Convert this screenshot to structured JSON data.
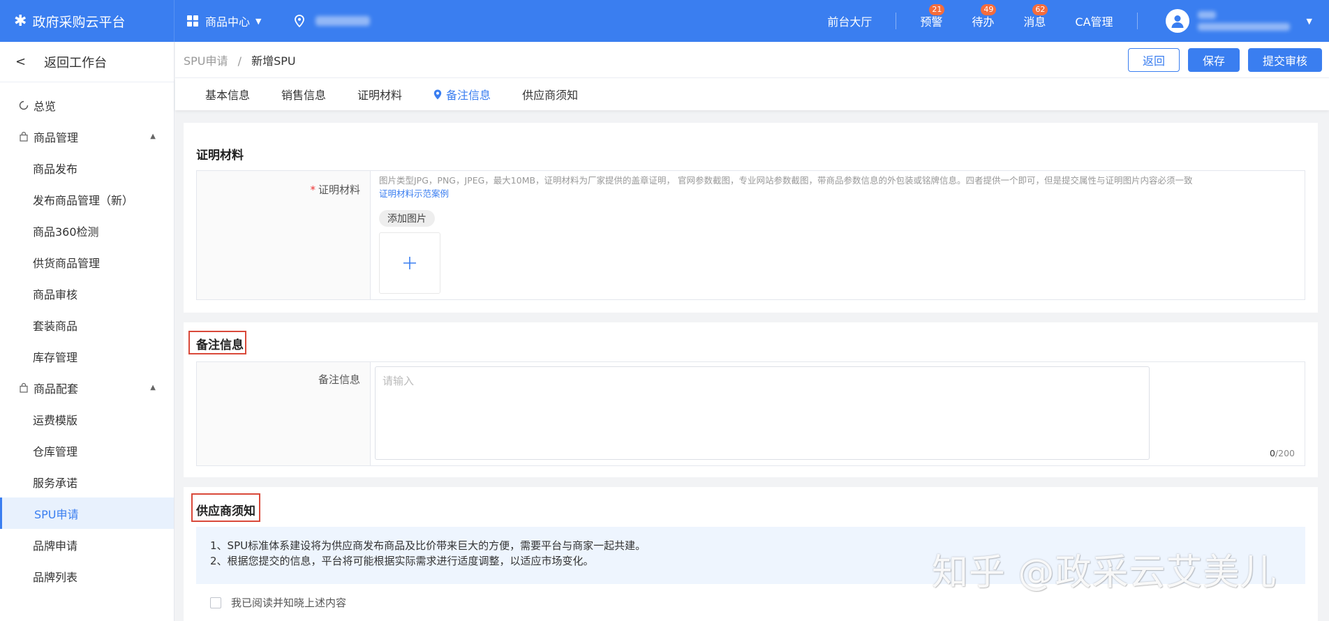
{
  "topbar": {
    "brand": "政府采购云平台",
    "nav_menu": "商品中心",
    "links": {
      "front_hall": "前台大厅",
      "warning": "预警",
      "todo": "待办",
      "messages": "消息",
      "ca": "CA管理"
    },
    "badges": {
      "warning": "21",
      "todo": "49",
      "messages": "62"
    }
  },
  "sidebar": {
    "back": "返回工作台",
    "overview": "总览",
    "group1": "商品管理",
    "group1_items": [
      "商品发布",
      "发布商品管理（新）",
      "商品360检测",
      "供货商品管理",
      "商品审核",
      "套装商品",
      "库存管理"
    ],
    "group2": "商品配套",
    "group2_items": [
      "运费模版",
      "仓库管理",
      "服务承诺",
      "SPU申请",
      "品牌申请",
      "品牌列表"
    ],
    "active_item": "SPU申请"
  },
  "breadcrumb": {
    "parent": "SPU申请",
    "sep": "/",
    "current": "新增SPU"
  },
  "actions": {
    "back": "返回",
    "save": "保存",
    "submit": "提交审核"
  },
  "tabs": [
    "基本信息",
    "销售信息",
    "证明材料",
    "备注信息",
    "供应商须知"
  ],
  "active_tab": "备注信息",
  "proof": {
    "title": "证明材料",
    "label": "证明材料",
    "hint": "图片类型JPG，PNG，JPEG，最大10MB，证明材料为厂家提供的盖章证明， 官网参数截图，专业网站参数截图，带商品参数信息的外包装或铭牌信息。四者提供一个即可，但是提交属性与证明图片内容必须一致",
    "example_link": "证明材料示范案例",
    "add_image": "添加图片",
    "plus": "+"
  },
  "remark": {
    "title": "备注信息",
    "label": "备注信息",
    "placeholder": "请输入",
    "value": "",
    "count": "0",
    "max": "/200"
  },
  "notice": {
    "title": "供应商须知",
    "line1": "1、SPU标准体系建设将为供应商发布商品及比价带来巨大的方便，需要平台与商家一起共建。",
    "line2": "2、根据您提交的信息，平台将可能根据实际需求进行适度调整，以适应市场变化。",
    "agree": "我已阅读并知晓上述内容"
  },
  "watermark": "知乎 @政采云艾美儿",
  "colors": {
    "primary": "#3a7ef0",
    "badge": "#f56c3c",
    "highlight_box": "#d9493a"
  }
}
